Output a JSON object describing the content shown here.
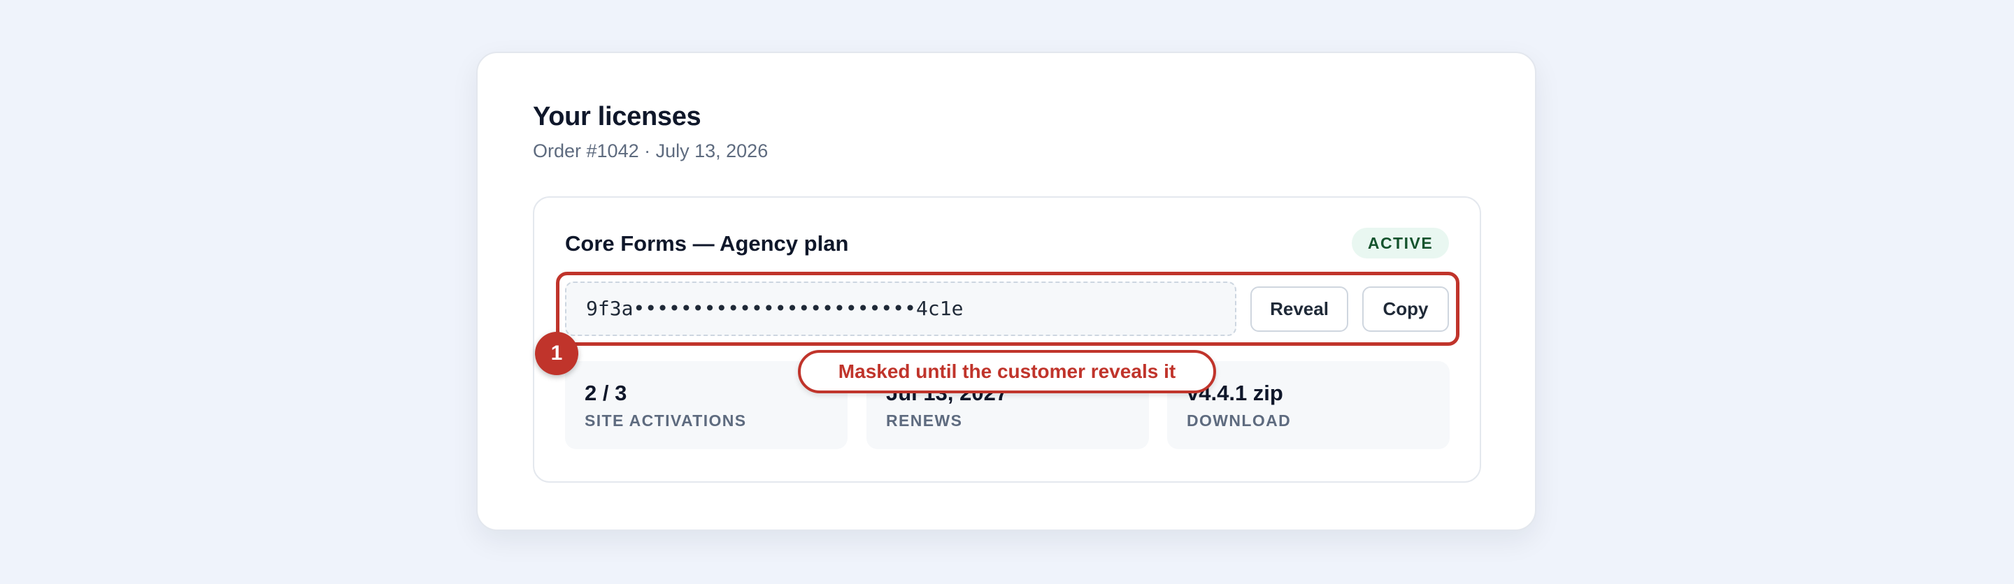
{
  "header": {
    "title": "Your licenses",
    "order_meta": "Order #1042 · July 13, 2026"
  },
  "license": {
    "plan_name": "Core Forms — Agency plan",
    "status": "ACTIVE",
    "masked_key": "9f3a••••••••••••••••••••••••4c1e",
    "actions": {
      "reveal_label": "Reveal",
      "copy_label": "Copy"
    },
    "stats": [
      {
        "value": "2 / 3",
        "label": "SITE ACTIVATIONS"
      },
      {
        "value": "Jul 13, 2027",
        "label": "RENEWS"
      },
      {
        "value": "v4.4.1 zip",
        "label": "DOWNLOAD"
      }
    ]
  },
  "annotation": {
    "number": "1",
    "text": "Masked until the customer reveals it"
  },
  "colors": {
    "background": "#eff3fb",
    "accent_annotation": "#c0342b",
    "status_badge_bg": "#e9f7f1",
    "status_badge_text": "#14532d",
    "text_primary": "#0f172a",
    "text_muted": "#5e6b7f"
  }
}
